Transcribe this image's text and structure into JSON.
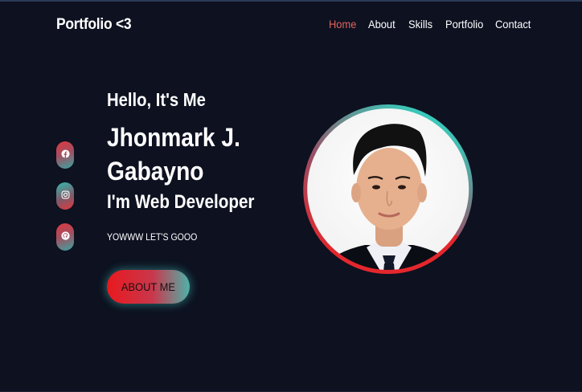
{
  "brand": {
    "logo": "Portfolio <3"
  },
  "nav": {
    "items": [
      {
        "label": "Home",
        "active": true
      },
      {
        "label": "About",
        "active": false
      },
      {
        "label": "Skills",
        "active": false
      },
      {
        "label": "Portfolio",
        "active": false
      },
      {
        "label": "Contact",
        "active": false
      }
    ]
  },
  "social": [
    {
      "icon": "facebook-icon"
    },
    {
      "icon": "instagram-icon"
    },
    {
      "icon": "github-icon"
    }
  ],
  "hero": {
    "greeting": "Hello, It's Me",
    "name": "Jhonmark J. Gabayno",
    "role": "I'm Web Developer",
    "tagline": "YOWWW LET'S GOOO",
    "cta_label": "ABOUT ME"
  },
  "colors": {
    "background": "#0d1120",
    "accent_red": "#e8191f",
    "accent_teal": "#3cc7b8",
    "nav_active": "#e2625c"
  }
}
